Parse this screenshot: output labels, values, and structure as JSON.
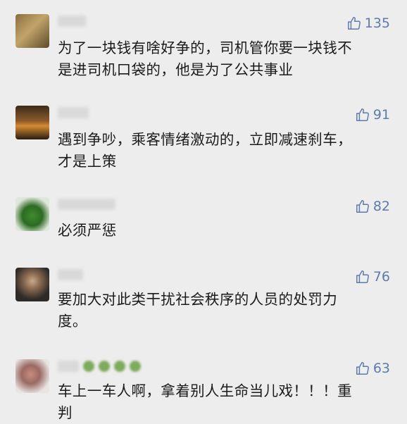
{
  "comments": [
    {
      "likes": "135",
      "text_lines": [
        "为了一块钱有啥好争的，司机管你要一块钱不",
        "是进司机口袋的，他是为了公共事业"
      ]
    },
    {
      "likes": "91",
      "text_lines": [
        "遇到争吵，乘客情绪激动的，立即减速刹车，",
        "才是上策"
      ]
    },
    {
      "likes": "82",
      "text_lines": [
        "必须严惩"
      ]
    },
    {
      "likes": "76",
      "text_lines": [
        "要加大对此类干扰社会秩序的人员的处罚力",
        "度。"
      ]
    },
    {
      "likes": "63",
      "text_lines": [
        "车上一车人啊，拿着别人生命当儿戏！！！重",
        "判"
      ]
    }
  ],
  "icons": {
    "like": "thumbs-up-icon"
  },
  "colors": {
    "like_color": "#5d7bab",
    "background": "#ededed"
  }
}
